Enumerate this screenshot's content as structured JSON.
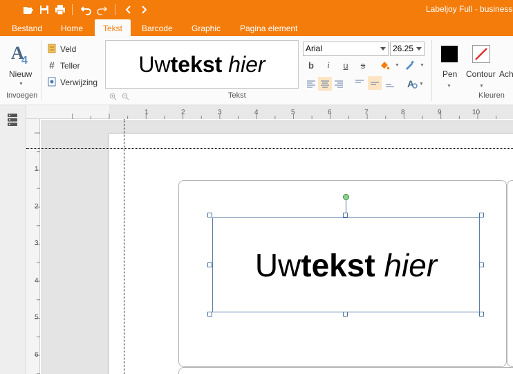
{
  "window": {
    "title": "Labeljoy Full - business-"
  },
  "quick_access": {
    "icons": [
      "open-folder-icon",
      "save-icon",
      "print-icon",
      "undo-icon",
      "redo-icon",
      "back-icon",
      "forward-icon"
    ]
  },
  "tabs": [
    {
      "label": "Bestand"
    },
    {
      "label": "Home"
    },
    {
      "label": "Tekst"
    },
    {
      "label": "Barcode"
    },
    {
      "label": "Graphic"
    },
    {
      "label": "Pagina element"
    }
  ],
  "active_tab": "Tekst",
  "ribbon": {
    "new_label": "Nieuw",
    "invoegen_label": "Invoegen",
    "field_label": "Veld",
    "counter_label": "Teller",
    "reference_label": "Verwijzing",
    "preview": {
      "normal": "Uw ",
      "bold": "tekst",
      "italic": "hier"
    },
    "tekst_group_label": "Tekst",
    "font_name": "Arial",
    "font_size": "26.25",
    "pen_label": "Pen",
    "contour_label": "Contour",
    "extra_label": "Ach",
    "colors_group_label": "Kleuren"
  },
  "ruler": {
    "h_numbers": [
      "1",
      "2",
      "3",
      "4",
      "5",
      "6",
      "7",
      "8",
      "9",
      "10"
    ],
    "v_numbers": [
      "1",
      "2",
      "3",
      "4",
      "5",
      "6"
    ]
  },
  "canvas": {
    "text_object": {
      "normal": "Uw ",
      "bold": "tekst",
      "italic": "hier"
    }
  },
  "colors": {
    "accent": "#f37c0b",
    "pen": "#000000",
    "contour_slash": "#e0302c"
  }
}
